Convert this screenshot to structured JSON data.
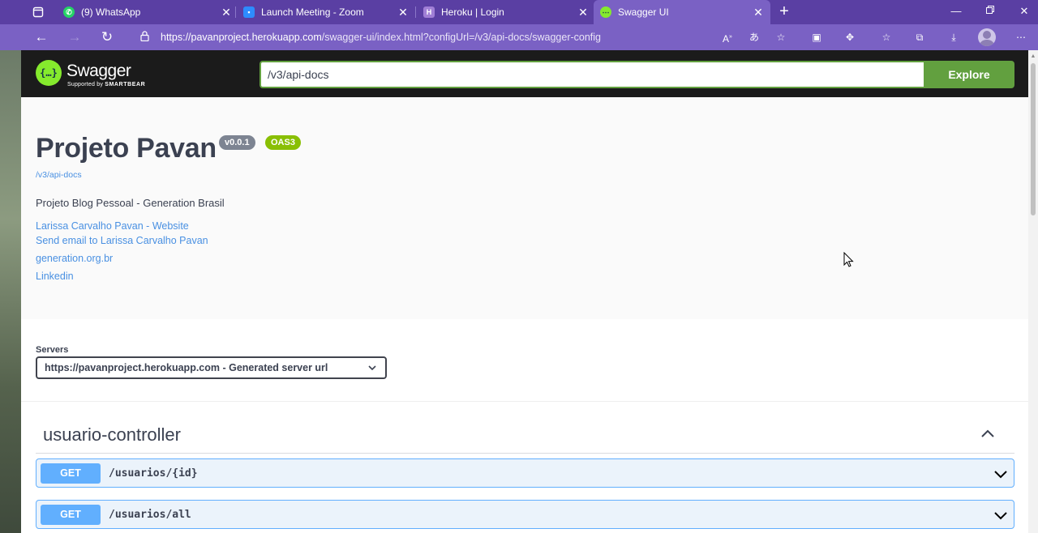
{
  "browser": {
    "tabs": [
      {
        "title": "(9) WhatsApp",
        "favicon": "whatsapp-icon",
        "active": false
      },
      {
        "title": "Launch Meeting - Zoom",
        "favicon": "zoom-icon",
        "active": false
      },
      {
        "title": "Heroku | Login",
        "favicon": "heroku-icon",
        "active": false
      },
      {
        "title": "Swagger UI",
        "favicon": "swagger-icon",
        "active": true
      }
    ],
    "url_host": "https://pavanproject.herokuapp.com",
    "url_path": "/swagger-ui/index.html?configUrl=/v3/api-docs/swagger-config",
    "colors": {
      "chrome": "#5a3fa3",
      "active_tab": "#7a61c4"
    }
  },
  "swagger": {
    "logo_text": "Swagger",
    "logo_sub_prefix": "Supported by",
    "logo_sub_brand": "SMARTBEAR",
    "spec_url": "/v3/api-docs",
    "explore_label": "Explore"
  },
  "info": {
    "title": "Projeto Pavan",
    "version_badge": "v0.0.1",
    "oas_badge": "OAS3",
    "base_url": "/v3/api-docs",
    "description": "Projeto Blog Pessoal - Generation Brasil",
    "links": [
      "Larissa Carvalho Pavan - Website",
      "Send email to Larissa Carvalho Pavan",
      "generation.org.br",
      "Linkedin"
    ]
  },
  "servers": {
    "label": "Servers",
    "selected": "https://pavanproject.herokuapp.com - Generated server url"
  },
  "controller": {
    "name": "usuario-controller",
    "operations": [
      {
        "method": "GET",
        "path": "/usuarios/{id}"
      },
      {
        "method": "GET",
        "path": "/usuarios/all"
      }
    ]
  }
}
